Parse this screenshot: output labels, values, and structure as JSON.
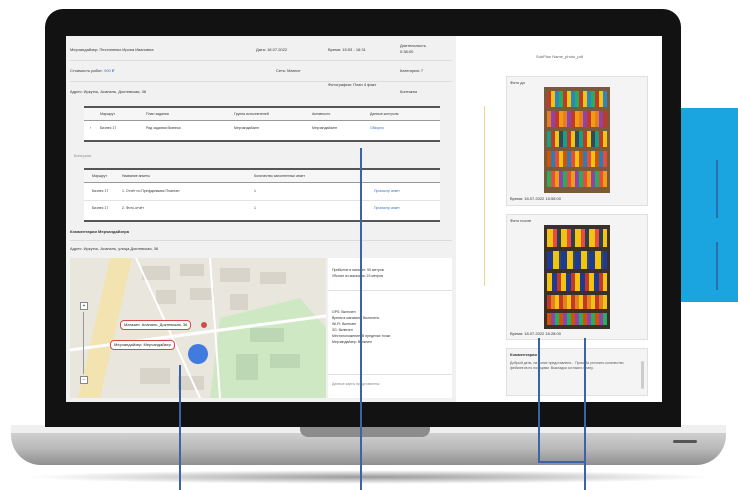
{
  "colors": {
    "accent": "#1aa5e0",
    "link": "#3a6fc4",
    "marker": "#2f6fe0",
    "callout": "#3b63a8"
  },
  "left": {
    "rows": [
      {
        "label": "Мерчандайзер: Пестипенко Ирина Ивановна",
        "date": "Дата: 18.07.2022",
        "time": "Время: 15:53 - 16:31",
        "duration_label": "Длительность",
        "duration_value": "0:38:00"
      },
      {
        "label": "Стоимость работ:",
        "label_value": "900 ₽",
        "client": "Сеть: Магнит",
        "category": "Категория: 7"
      },
      {
        "label": "Адрес: Иркутск, Асаналь, Доктевская, 36",
        "photo_label": "Фотографии: План 4 факт",
        "note": "Контакты"
      }
    ],
    "table1": {
      "headers": [
        "Маршрут",
        "План задания",
        "Группа исполнителей",
        "Активность",
        "Данные контроля"
      ],
      "rows": [
        [
          "Бизнес 17",
          "Рад задания бизнеса",
          "Мерчандайзинг",
          "Мерчандайзинг",
          "Обзорно"
        ]
      ],
      "footer": "Контроль"
    },
    "table2": {
      "headers": [
        "Маршрут",
        "Название анкеты",
        "Количество заполненных анкет"
      ],
      "rows": [
        [
          "Бизнес 17",
          "1. Отчёт по Префдинамах Плантан",
          "1",
          "Просмотр анкет"
        ],
        [
          "Бизнес 17",
          "2. Фото-отчёт",
          "1",
          "Просмотр анкет"
        ]
      ]
    },
    "comment_title": "Комментарии Мерчандайзера",
    "address_line": "Адрес: Иркутск, Асаналь, улица Доктевская, 36",
    "map": {
      "label_shop": "Магазин: Асаналь, Доктевская, 36",
      "label_merch": "Мерчандайзер: Мерчандайзер",
      "zoom_in": "+",
      "zoom_out": "−"
    },
    "map_side": {
      "block1": [
        "Прибытие в магазин: 50 метров",
        "Убытие из магазина: 23 метров"
      ],
      "block2": [
        "GPS: Включен",
        "Время в магазине: Включено",
        "Wi-Fi: Включен",
        "3G: Включен",
        "Местоположение: В пределах точки",
        "Мерчандайзер: Включен"
      ],
      "footer": "Данные карты представлены"
    }
  },
  "right": {
    "title": "SubPlan Name_photo_pdf",
    "photo_before": "Фото до",
    "time_before": "Время: 18.07.2022 15:55:00",
    "photo_after": "Фото после",
    "time_after": "Время: 18.07.2022 16:28:00",
    "comment_title": "Комментарии",
    "comment_text": "Добрый день, на полке представлено... Просьба уточнить количество фейсингов по позициям. Выкладка согласно плану."
  }
}
